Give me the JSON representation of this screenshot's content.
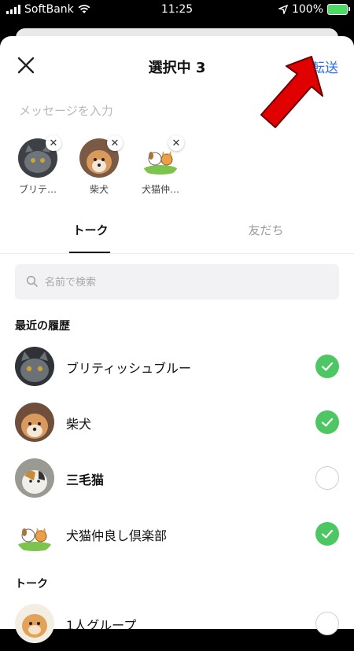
{
  "status_bar": {
    "carrier": "SoftBank",
    "time": "11:25",
    "battery": "100%"
  },
  "header": {
    "title": "選択中 3",
    "forward_label": "転送"
  },
  "message": {
    "placeholder": "メッセージを入力"
  },
  "selected": [
    {
      "label": "ブリテ…"
    },
    {
      "label": "柴犬"
    },
    {
      "label": "犬猫仲…"
    }
  ],
  "tabs": {
    "talk": "トーク",
    "friends": "友だち"
  },
  "search": {
    "placeholder": "名前で検索"
  },
  "sections": {
    "recent": "最近の履歴",
    "talk": "トーク"
  },
  "recent": [
    {
      "name": "ブリティッシュブルー",
      "checked": true
    },
    {
      "name": "柴犬",
      "checked": true
    },
    {
      "name": "三毛猫",
      "checked": false
    },
    {
      "name": "犬猫仲良し倶楽部",
      "checked": true
    }
  ],
  "talk_list": [
    {
      "name": "1人グループ",
      "checked": false
    }
  ],
  "colors": {
    "accent": "#2f6ff6",
    "check": "#4cc764",
    "arrow": "#e00000"
  }
}
